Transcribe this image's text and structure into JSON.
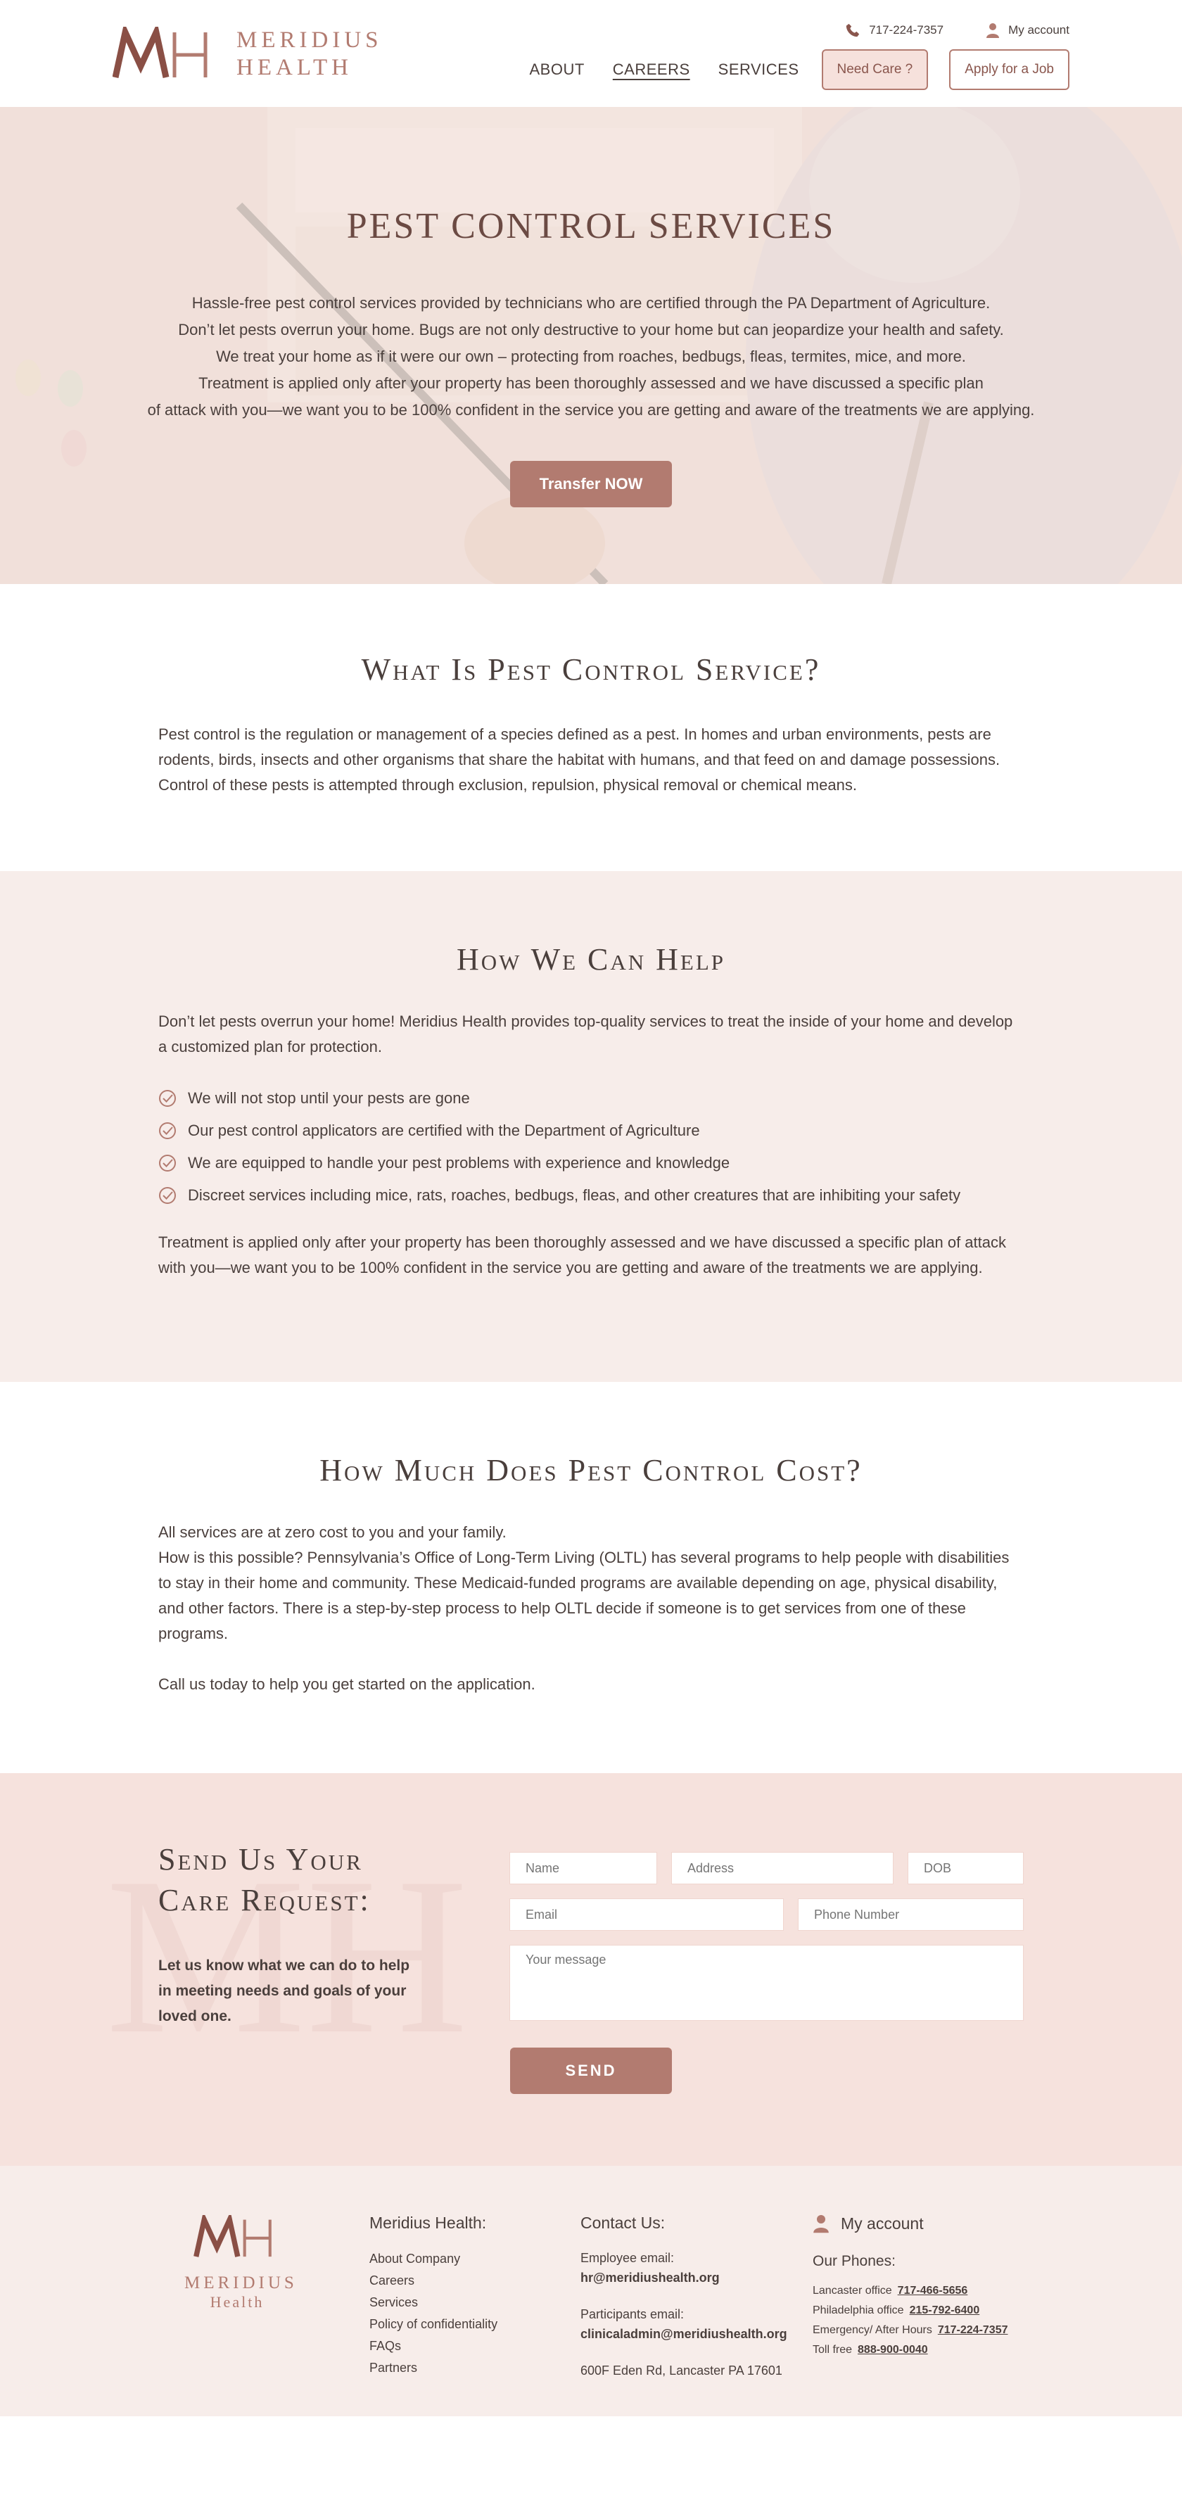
{
  "header": {
    "logo_line1": "MERIDIUS",
    "logo_line2": "HEALTH",
    "phone": "717-224-7357",
    "account": "My account",
    "nav": [
      "ABOUT",
      "CAREERS",
      "SERVICES"
    ],
    "need_care": "Need Care ?",
    "apply": "Apply for a Job"
  },
  "hero": {
    "title": "PEST CONTROL SERVICES",
    "lines": [
      "Hassle-free pest control services provided by technicians who are certified through the PA Department of Agriculture.",
      "Don’t let pests overrun your home. Bugs are not only destructive to your home but can jeopardize your health and safety.",
      "We treat your home as if it were our own – protecting from roaches, bedbugs, fleas, termites, mice, and more.",
      "Treatment is applied only after your property has been thoroughly assessed and we have discussed a specific plan",
      "of attack with you—we want you to be 100% confident in the service you are getting and aware of the treatments we are applying."
    ],
    "button": "Transfer NOW"
  },
  "what": {
    "title": "What Is Pest Control Service?",
    "text": "Pest control is the regulation or management of a species defined as a pest. In homes and urban environments, pests are rodents, birds, insects and other organisms that share the habitat with humans, and that feed on and damage possessions. Control of these pests is attempted through exclusion, repulsion, physical removal or chemical means."
  },
  "help": {
    "title": "How We Can Help",
    "intro": "Don’t let pests overrun your home! Meridius Health provides top-quality services to treat the inside of your home and develop a customized plan for protection.",
    "items": [
      "We will not stop until your pests are gone",
      "Our pest control applicators are certified with the Department of Agriculture",
      "We are equipped to handle your pest problems with experience and knowledge",
      "Discreet services including mice, rats, roaches, bedbugs, fleas, and other creatures that are inhibiting your safety"
    ],
    "outro": "Treatment is applied only after your property has been thoroughly assessed and we have discussed a specific plan of attack with you—we want you to be 100% confident in the service you are getting and aware of the treatments we are applying."
  },
  "cost": {
    "title": "How Much Does Pest Control Cost?",
    "line1": "All services are at zero cost to you and your family.",
    "text": "How is this possible? Pennsylvania’s Office of Long-Term Living (OLTL) has several programs to help people with disabilities to stay in their home and community. These Medicaid-funded programs are available depending on age, physical disability, and other factors.  There is a step-by-step process to help OLTL decide if someone is to get services from one of these programs.",
    "cta": "Call us today to help you get started on the application."
  },
  "form": {
    "watermark": "MH",
    "title": "Send Us Your Care Request:",
    "lead": "Let us know what we can do to help in meeting needs and goals of your loved one.",
    "name": "Name",
    "address": "Address",
    "dob": "DOB",
    "email": "Email",
    "phone": "Phone Number",
    "message": "Your message",
    "send": "SEND"
  },
  "footer": {
    "logo_name": "MERIDIUS",
    "logo_sub": "Health",
    "col1_title": "Meridius Health:",
    "links": [
      "About Company",
      "Careers",
      "Services",
      "Policy of confidentiality",
      "FAQs",
      "Partners"
    ],
    "contact_title": "Contact Us:",
    "emp_label": "Employee email:",
    "emp_email": "hr@meridiushealth.org",
    "part_label": "Participants email:",
    "part_email": "clinicaladmin@meridiushealth.org",
    "address": "600F Eden Rd, Lancaster PA 17601",
    "account": "My account",
    "phones_title": "Our Phones:",
    "phones": [
      {
        "label": "Lancaster office",
        "num": "717-466-5656"
      },
      {
        "label": "Philadelphia office",
        "num": "215-792-6400"
      },
      {
        "label": "Emergency/ After Hours",
        "num": "717-224-7357"
      },
      {
        "label": "Toll free",
        "num": "888-900-0040"
      }
    ]
  },
  "colors": {
    "accent": "#b27b70",
    "blush": "#f6e2dd",
    "cream": "#f7edea"
  }
}
